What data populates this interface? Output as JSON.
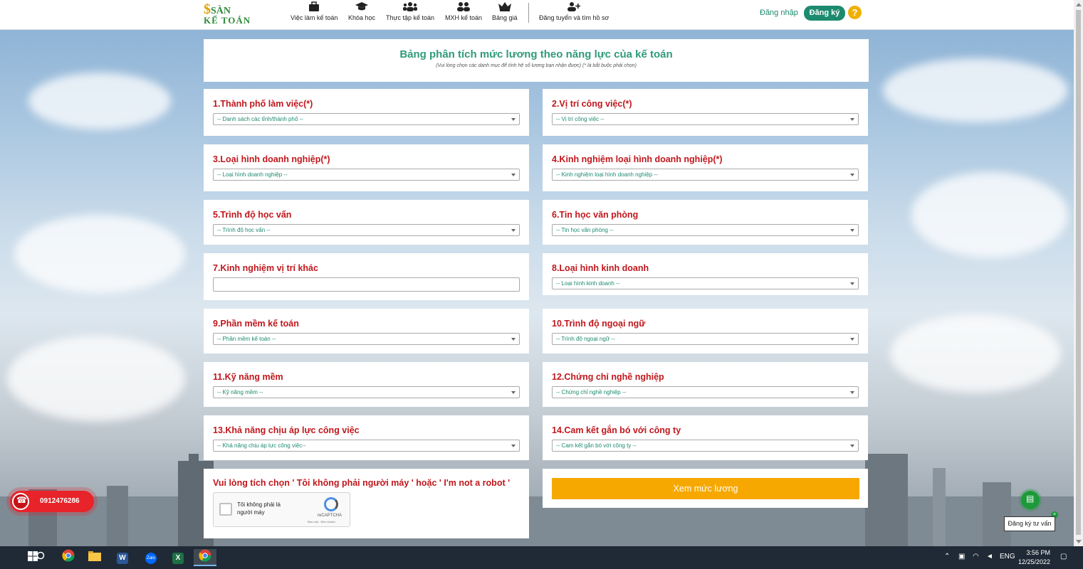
{
  "header": {
    "logo_line1": "SÀN",
    "logo_line2": "KẾ TOÁN",
    "nav": [
      {
        "label": "Việc làm kế toán",
        "icon": "briefcase-icon"
      },
      {
        "label": "Khóa học",
        "icon": "graduation-cap-icon"
      },
      {
        "label": "Thực tập kế toán",
        "icon": "users-icon"
      },
      {
        "label": "MXH kế toán",
        "icon": "user-group-icon"
      },
      {
        "label": "Bảng giá",
        "icon": "crown-icon"
      },
      {
        "label": "Đăng tuyển và tìm hồ sơ",
        "icon": "user-plus-icon"
      }
    ],
    "login": "Đăng nhập",
    "register": "Đăng ký",
    "help": "?"
  },
  "title": {
    "heading": "Bảng phân tích mức lương theo năng lực của kế toán",
    "subtitle": "(Vui lòng chọn các danh mục để tính hệ số lương bạn nhận được) (* là bắt buộc phải chọn)"
  },
  "fields": [
    {
      "label": "1.Thành phố làm việc(*)",
      "placeholder": "-- Danh sách các tỉnh/thành phố --"
    },
    {
      "label": "2.Vị trí công việc(*)",
      "placeholder": "-- Vị trí công việc --"
    },
    {
      "label": "3.Loại hình doanh nghiệp(*)",
      "placeholder": "-- Loại hình doanh nghiệp --"
    },
    {
      "label": "4.Kinh nghiệm loại hình doanh nghiệp(*)",
      "placeholder": "-- Kinh nghiệm loại hình doanh nghiệp --"
    },
    {
      "label": "5.Trình độ học vấn",
      "placeholder": "-- Trình độ học vấn --"
    },
    {
      "label": "6.Tin học văn phòng",
      "placeholder": "-- Tin học văn phòng --"
    },
    {
      "label": "7.Kinh nghiệm vị trí khác",
      "placeholder": ""
    },
    {
      "label": "8.Loại hình kinh doanh",
      "placeholder": "-- Loại hình kinh doanh --"
    },
    {
      "label": "9.Phần mềm kế toán",
      "placeholder": "-- Phần mềm kế toán --"
    },
    {
      "label": "10.Trình độ ngoại ngữ",
      "placeholder": "-- Trình độ ngoại ngữ --"
    },
    {
      "label": "11.Kỹ năng mềm",
      "placeholder": "-- Kỹ năng mềm --"
    },
    {
      "label": "12.Chứng chỉ nghề nghiệp",
      "placeholder": "-- Chứng chỉ nghề nghiệp --"
    },
    {
      "label": "13.Khả năng chịu áp lực công việc",
      "placeholder": "-- Khả năng chịu áp lực công việc--"
    },
    {
      "label": "14.Cam kết gắn bó với công ty",
      "placeholder": "-- Cam kết gắn bó với công ty --"
    }
  ],
  "robot": {
    "label": "Vui lòng tích chọn ' Tôi không phải người máy ' hoặc ' I'm not a robot '",
    "checkbox_text": "Tôi không phải là người máy",
    "recaptcha": "reCAPTCHA",
    "links": "Bảo mật - Điều khoản"
  },
  "submit": "Xem mức lương",
  "phone": "0912476286",
  "consult": "Đăng ký tư vấn",
  "taskbar": {
    "lang": "ENG",
    "time": "3:56 PM",
    "date": "12/25/2022"
  }
}
